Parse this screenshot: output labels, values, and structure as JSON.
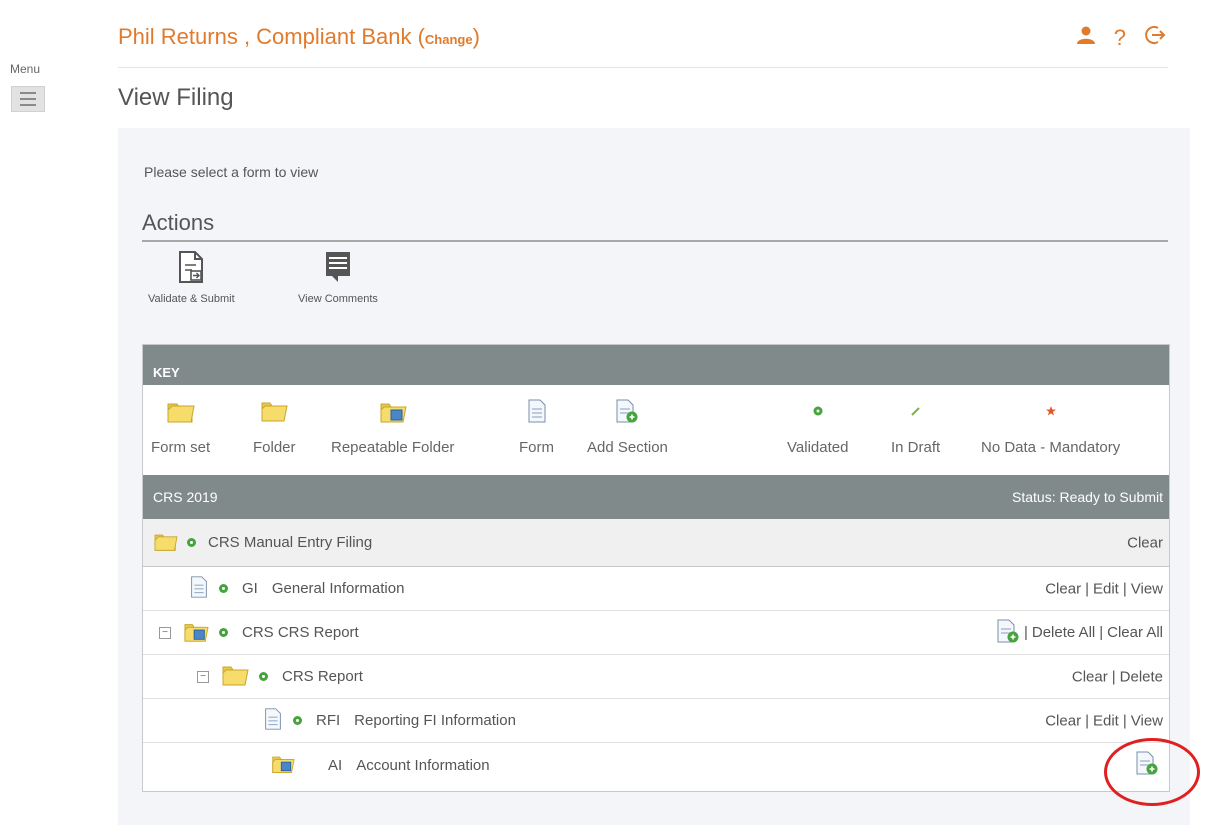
{
  "menu": {
    "label": "Menu"
  },
  "header": {
    "title": "Phil Returns , Compliant Bank (",
    "change_label": "Change",
    "title_suffix": ")",
    "icons": [
      "user-icon",
      "help-icon",
      "logout-icon"
    ]
  },
  "page": {
    "title": "View Filing"
  },
  "panel": {
    "prompt": "Please select a form to view",
    "actions_title": "Actions",
    "actions": [
      {
        "label": "Validate & Submit",
        "icon": "validate-submit-icon"
      },
      {
        "label": "View Comments",
        "icon": "comments-icon"
      }
    ]
  },
  "key": {
    "title": "KEY",
    "items": [
      {
        "label": "Form set",
        "icon": "form-set-icon"
      },
      {
        "label": "Folder",
        "icon": "folder-icon"
      },
      {
        "label": "Repeatable Folder",
        "icon": "repeatable-folder-icon"
      },
      {
        "label": "Form",
        "icon": "form-icon"
      },
      {
        "label": "Add Section",
        "icon": "add-section-icon"
      },
      {
        "label": "Validated",
        "icon": "validated-icon"
      },
      {
        "label": "In Draft",
        "icon": "in-draft-icon"
      },
      {
        "label": "No Data - Mandatory",
        "icon": "no-data-mandatory-icon"
      }
    ]
  },
  "filing": {
    "name": "CRS 2019",
    "status": "Status: Ready to Submit",
    "rows": [
      {
        "label": "CRS Manual Entry Filing",
        "actions": [
          "Clear"
        ]
      },
      {
        "code": "GI",
        "label": "General Information",
        "actions": [
          "Clear",
          "Edit",
          "View"
        ]
      },
      {
        "label": "CRS CRS Report",
        "actions": [
          "Delete All",
          "Clear All"
        ]
      },
      {
        "label": "CRS Report",
        "actions": [
          "Clear",
          "Delete"
        ]
      },
      {
        "code": "RFI",
        "label": "Reporting FI Information",
        "actions": [
          "Clear",
          "Edit",
          "View"
        ]
      },
      {
        "code": "AI",
        "label": "Account Information"
      }
    ],
    "separator": "|"
  },
  "colors": {
    "brand": "#e07b2e",
    "header_bar": "#808a8b",
    "validated": "#45a43c",
    "highlight": "#e02020"
  }
}
